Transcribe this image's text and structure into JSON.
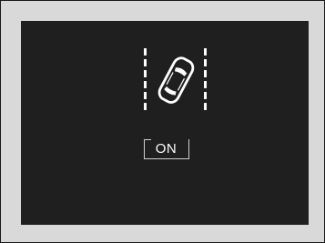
{
  "display": {
    "icon": "lane-keeping-car-icon",
    "status_label": "ON"
  },
  "colors": {
    "screen_background": "#1f1f1f",
    "frame_background": "#d9d9d9",
    "foreground": "#ffffff"
  }
}
